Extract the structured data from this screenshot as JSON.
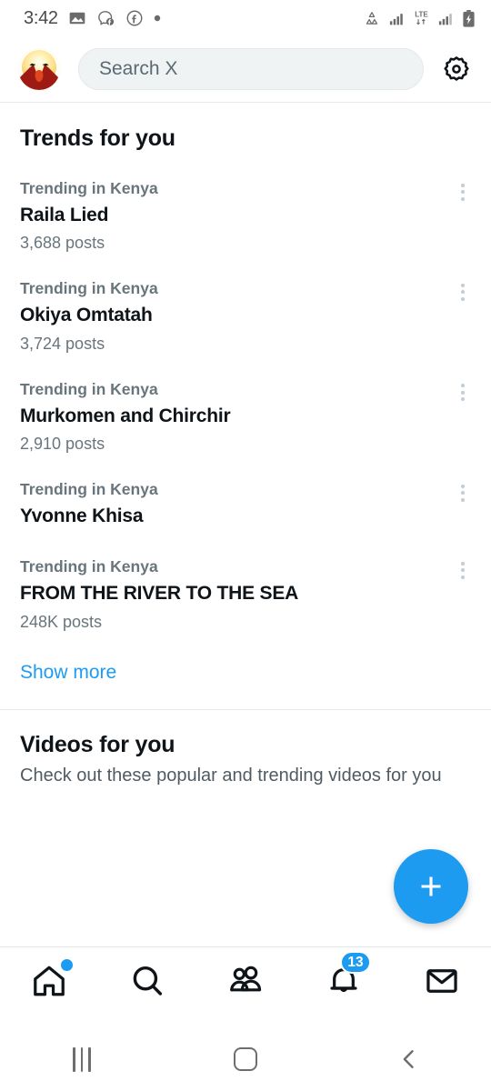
{
  "status_bar": {
    "time": "3:42",
    "left_icons": [
      "image-icon",
      "messenger-chat-icon",
      "facebook-icon",
      "dot-icon"
    ],
    "right_icons": [
      "data-saver-icon",
      "signal-bars-icon",
      "lte-icon",
      "signal-bars-2-icon",
      "battery-charging-icon"
    ],
    "network_label": "LTE"
  },
  "header": {
    "avatar_name": "profile-avatar",
    "search_placeholder": "Search X",
    "settings_icon": "gear-icon"
  },
  "main": {
    "trends_title": "Trends for you",
    "trends": [
      {
        "context": "Trending in Kenya",
        "name": "Raila Lied",
        "posts": "3,688 posts"
      },
      {
        "context": "Trending in Kenya",
        "name": "Okiya Omtatah",
        "posts": "3,724 posts"
      },
      {
        "context": "Trending in Kenya",
        "name": "Murkomen and Chirchir",
        "posts": "2,910 posts"
      },
      {
        "context": "Trending in Kenya",
        "name": "Yvonne Khisa",
        "posts": ""
      },
      {
        "context": "Trending in Kenya",
        "name": "FROM THE RIVER TO THE SEA",
        "posts": "248K posts"
      }
    ],
    "show_more": "Show more",
    "videos_title": "Videos for you",
    "videos_subtitle": "Check out these popular and trending videos for you"
  },
  "fab": {
    "label": "+",
    "icon": "plus-icon",
    "color": "#1d9bf0"
  },
  "bottom_nav": {
    "items": [
      {
        "name": "home",
        "icon": "home-icon",
        "badge_dot": true,
        "badge": ""
      },
      {
        "name": "search",
        "icon": "search-icon",
        "badge_dot": false,
        "badge": ""
      },
      {
        "name": "communities",
        "icon": "communities-icon",
        "badge_dot": false,
        "badge": ""
      },
      {
        "name": "notifications",
        "icon": "bell-icon",
        "badge_dot": false,
        "badge": "13"
      },
      {
        "name": "messages",
        "icon": "envelope-icon",
        "badge_dot": false,
        "badge": ""
      }
    ]
  },
  "system_nav": {
    "recents": "recents-icon",
    "home": "home-square-icon",
    "back": "back-chevron-icon"
  },
  "colors": {
    "accent": "#1d9bf0",
    "text_primary": "#0f1419",
    "text_secondary": "#68757d",
    "divider": "#e6eaec",
    "search_bg": "#eff3f4"
  }
}
